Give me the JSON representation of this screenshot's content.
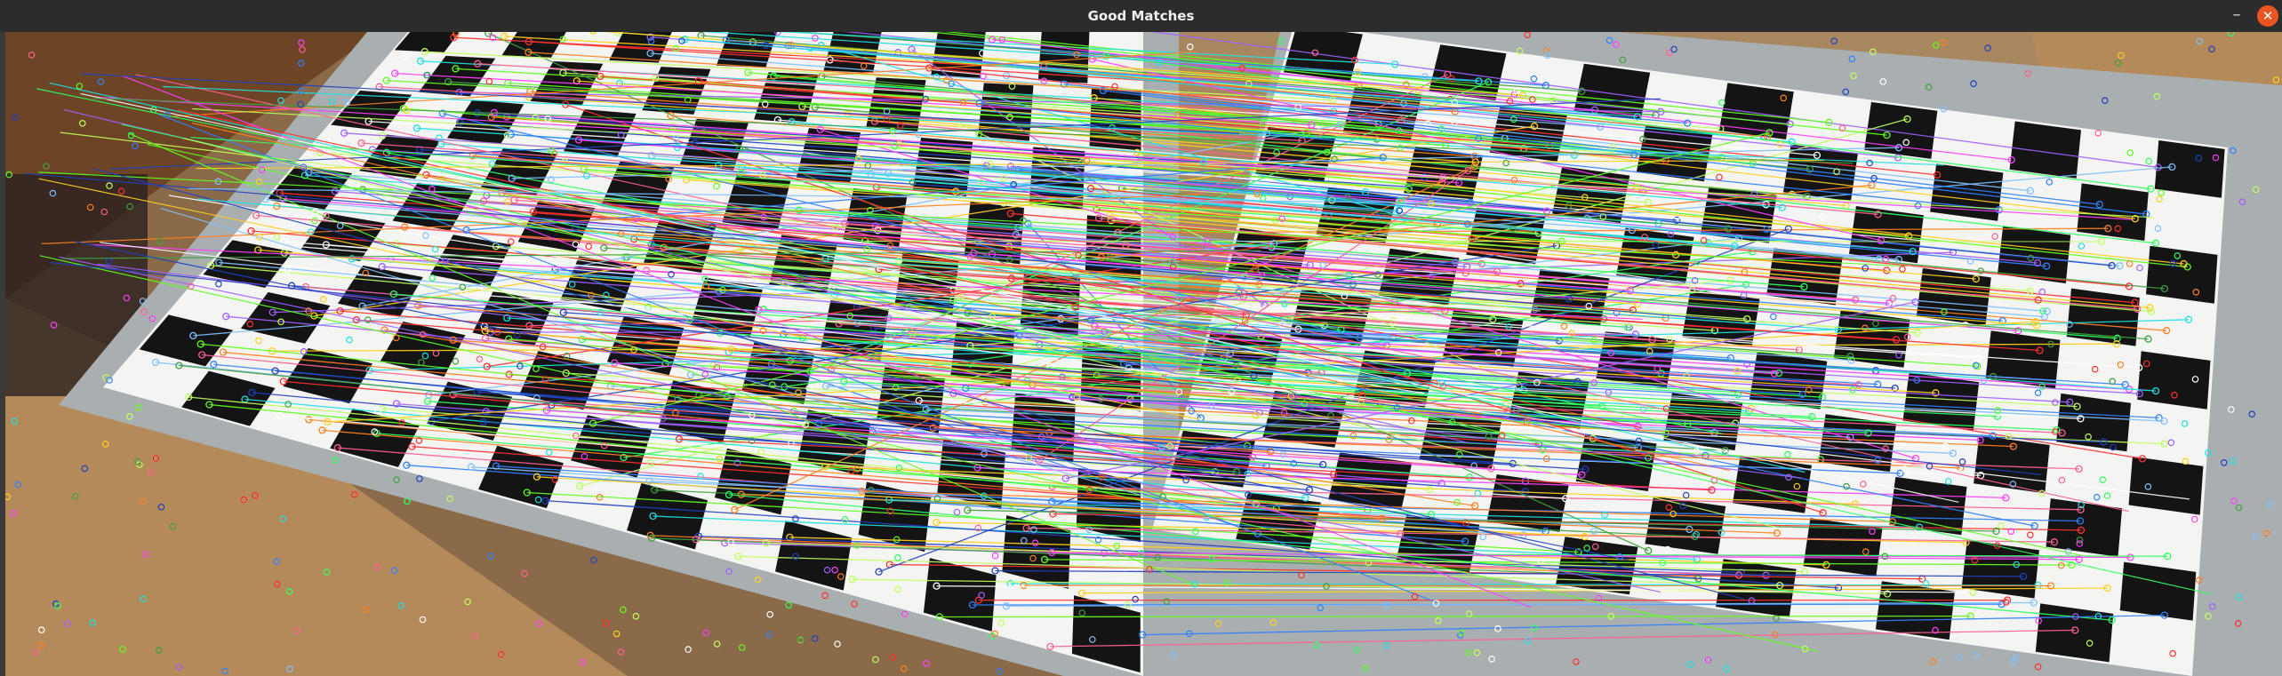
{
  "window": {
    "title": "Good Matches",
    "minimize_icon": "minimize-icon",
    "close_icon": "close-icon",
    "minimize_glyph": "–",
    "close_glyph": "✕"
  },
  "image": {
    "description_icon": "feature-matches-image",
    "colors": {
      "board_white": "#f4f4f2",
      "board_black": "#141414",
      "frame": "#a9aeb0",
      "wood": "#b48a5a",
      "dark_wood": "#6e4426",
      "close_button": "#e95420"
    }
  }
}
